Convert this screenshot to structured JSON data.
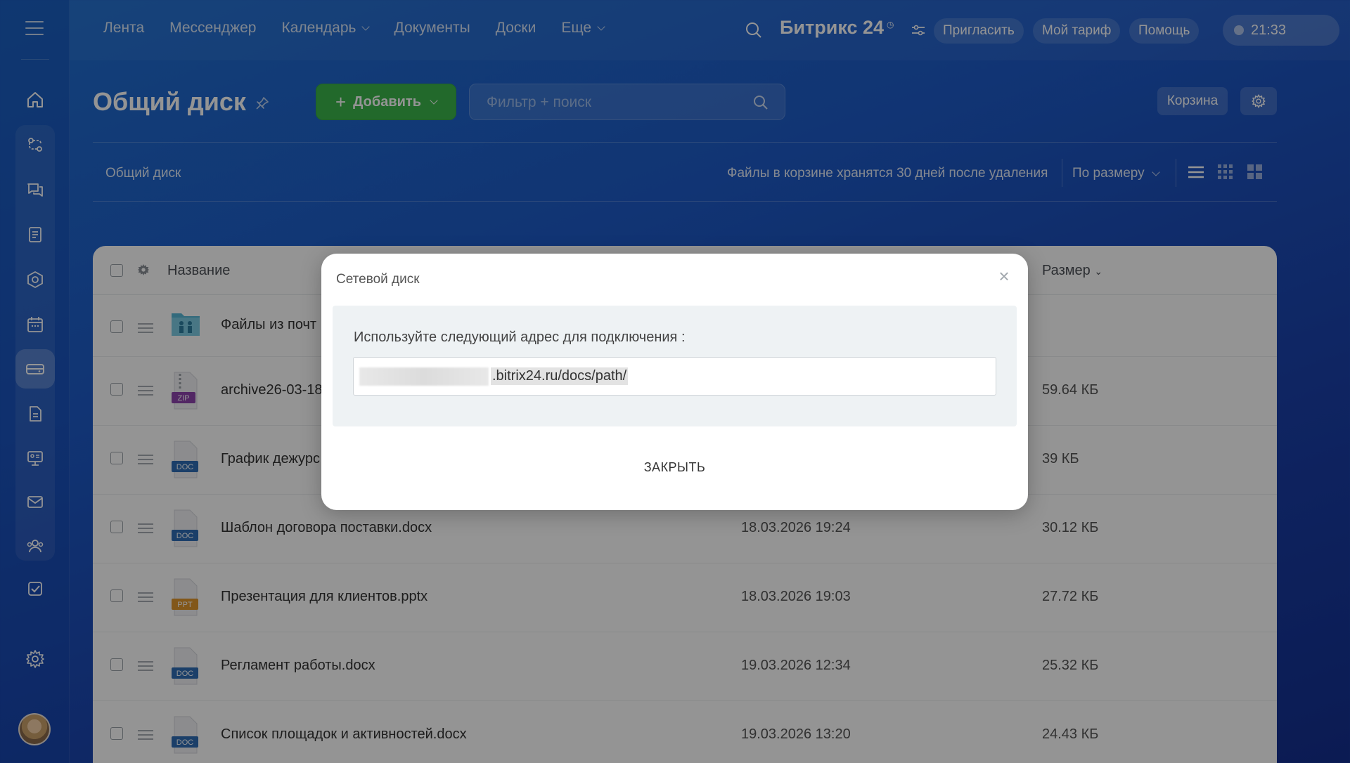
{
  "topnav": {
    "items": [
      {
        "label": "Лента",
        "dropdown": false
      },
      {
        "label": "Мессенджер",
        "dropdown": false
      },
      {
        "label": "Календарь",
        "dropdown": true
      },
      {
        "label": "Документы",
        "dropdown": false
      },
      {
        "label": "Доски",
        "dropdown": false
      },
      {
        "label": "Еще",
        "dropdown": true
      }
    ],
    "brand": "Битрикс 24",
    "invite_label": "Пригласить",
    "tariff_label": "Мой тариф",
    "help_label": "Помощь",
    "time": "21:33"
  },
  "page": {
    "title": "Общий диск",
    "add_label": "Добавить",
    "filter_placeholder": "Фильтр + поиск",
    "trash_label": "Корзина",
    "breadcrumb": "Общий диск",
    "trash_note": "Файлы в корзине хранятся 30 дней после удаления",
    "sort_label": "По размеру"
  },
  "table": {
    "col_name": "Название",
    "col_size": "Размер",
    "rows": [
      {
        "name": "Файлы из почт",
        "date": "",
        "size": "",
        "type": "folder"
      },
      {
        "name": "archive26-03-18",
        "date": "",
        "size": "59.64 КБ",
        "type": "ZIP"
      },
      {
        "name": "График дежурс",
        "date": "",
        "size": "39 КБ",
        "type": "DOC"
      },
      {
        "name": "Шаблон договора поставки.docx",
        "date": "18.03.2026 19:24",
        "size": "30.12 КБ",
        "type": "DOC"
      },
      {
        "name": "Презентация для клиентов.pptx",
        "date": "18.03.2026 19:03",
        "size": "27.72 КБ",
        "type": "PPT"
      },
      {
        "name": "Регламент работы.docx",
        "date": "19.03.2026 12:34",
        "size": "25.32 КБ",
        "type": "DOC"
      },
      {
        "name": "Список площадок и активностей.docx",
        "date": "19.03.2026 13:20",
        "size": "24.43 КБ",
        "type": "DOC"
      }
    ]
  },
  "modal": {
    "title": "Сетевой диск",
    "hint": "Используйте следующий адрес для подключения :",
    "address": ".bitrix24.ru/docs/path/",
    "close_label": "ЗАКРЫТЬ"
  },
  "colors": {
    "accent_green": "#3bb54a",
    "zip": "#8e44ad",
    "doc": "#2f6db5",
    "ppt": "#e0962b",
    "folder": "#56b7d6"
  }
}
